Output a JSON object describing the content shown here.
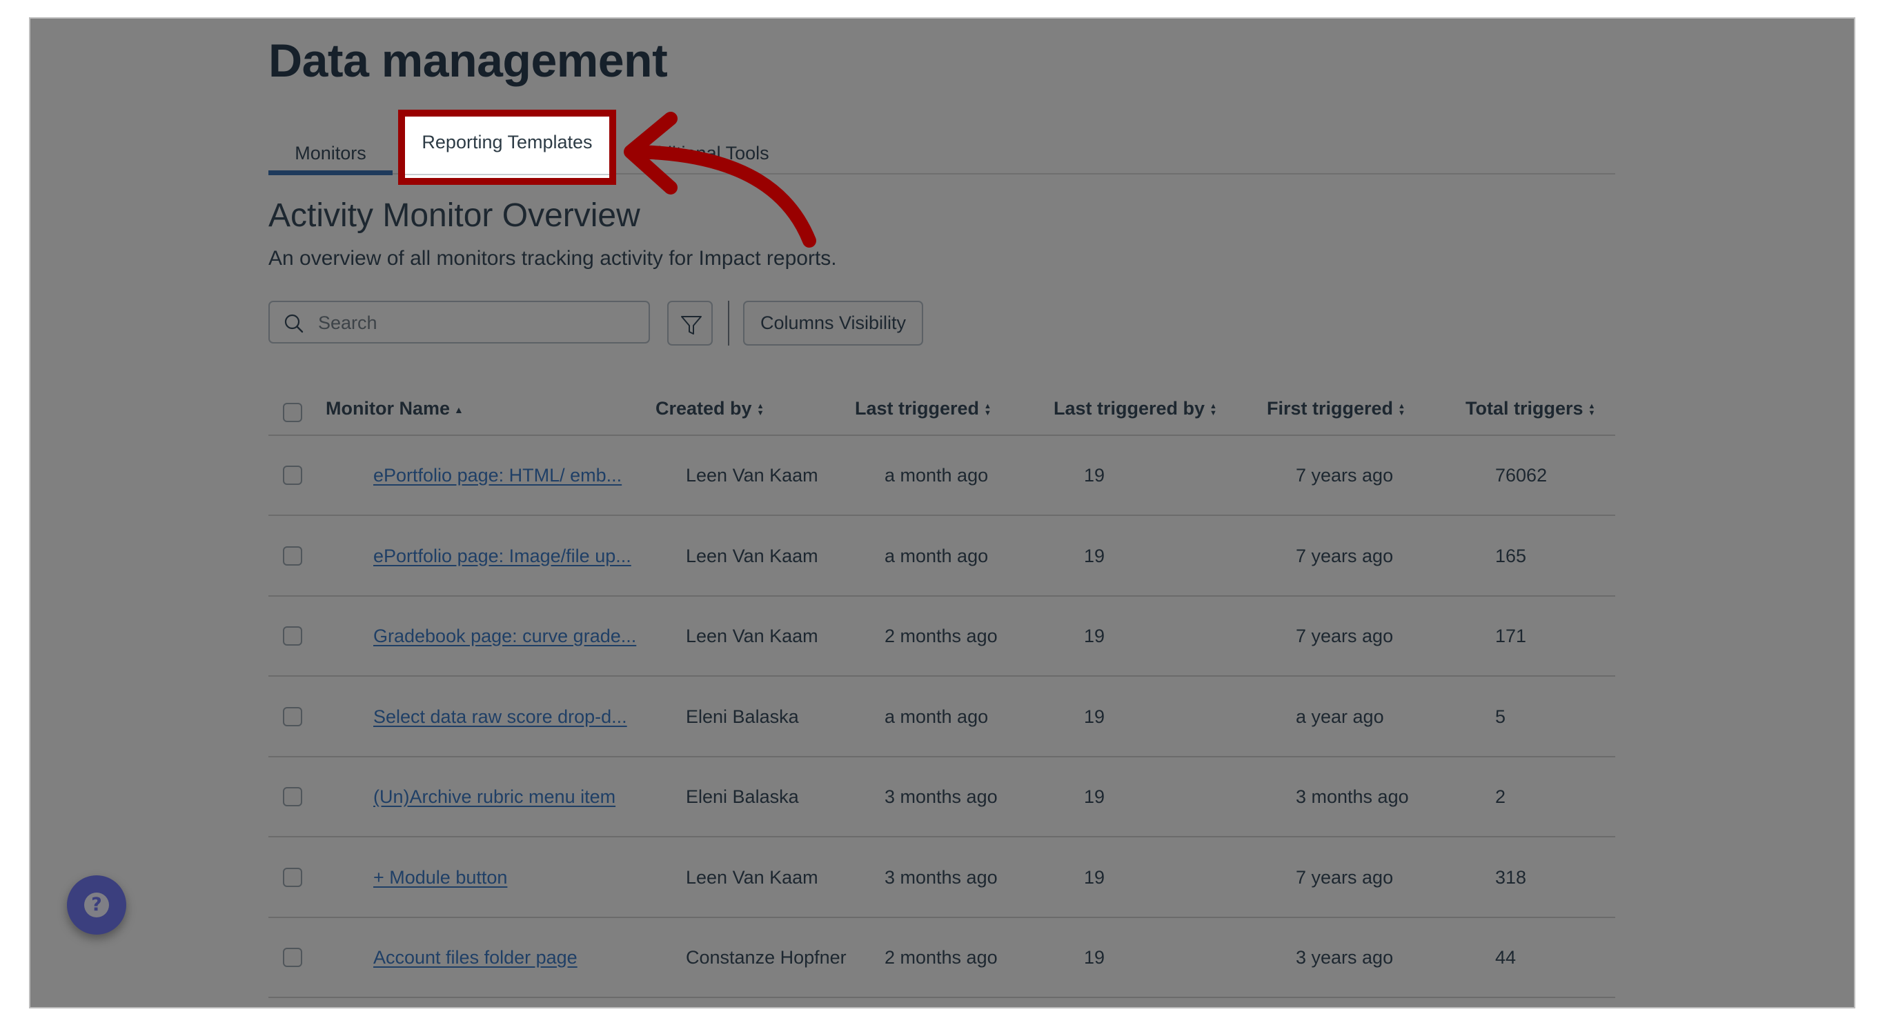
{
  "page": {
    "title": "Data management"
  },
  "tabs": [
    {
      "label": "Monitors",
      "selected": true
    },
    {
      "label": "Reporting Templates",
      "selected": false,
      "highlighted": true
    },
    {
      "label": "Additional Tools",
      "selected": false
    }
  ],
  "annotation": {
    "highlight_color": "#990000",
    "arrow_color": "#990000",
    "points_to": "Reporting Templates"
  },
  "section": {
    "title": "Activity Monitor Overview",
    "description": "An overview of all monitors tracking activity for Impact reports."
  },
  "toolbar": {
    "search_placeholder": "Search",
    "search_value": "",
    "filter_icon": "filter-icon",
    "columns_visibility_label": "Columns Visibility"
  },
  "table": {
    "columns": [
      {
        "label": "Monitor Name",
        "sort": "ascending"
      },
      {
        "label": "Created by",
        "sort": "none"
      },
      {
        "label": "Last triggered",
        "sort": "none"
      },
      {
        "label": "Last triggered by",
        "sort": "none"
      },
      {
        "label": "First triggered",
        "sort": "none"
      },
      {
        "label": "Total triggers",
        "sort": "none"
      }
    ],
    "rows": [
      {
        "name": "ePortfolio page: HTML/ emb...",
        "created_by": "Leen Van Kaam",
        "last_triggered": "a month ago",
        "last_triggered_by": "19",
        "first_triggered": "7 years ago",
        "total_triggers": "76062"
      },
      {
        "name": "ePortfolio page: Image/file up...",
        "created_by": "Leen Van Kaam",
        "last_triggered": "a month ago",
        "last_triggered_by": "19",
        "first_triggered": "7 years ago",
        "total_triggers": "165"
      },
      {
        "name": "Gradebook page: curve grade...",
        "created_by": "Leen Van Kaam",
        "last_triggered": "2 months ago",
        "last_triggered_by": "19",
        "first_triggered": "7 years ago",
        "total_triggers": "171"
      },
      {
        "name": "Select data raw score drop-d...",
        "created_by": "Eleni Balaska",
        "last_triggered": "a month ago",
        "last_triggered_by": "19",
        "first_triggered": "a year ago",
        "total_triggers": "5"
      },
      {
        "name": "(Un)Archive rubric menu item",
        "created_by": "Eleni Balaska",
        "last_triggered": "3 months ago",
        "last_triggered_by": "19",
        "first_triggered": "3 months ago",
        "total_triggers": "2"
      },
      {
        "name": "+ Module button",
        "created_by": "Leen Van Kaam",
        "last_triggered": "3 months ago",
        "last_triggered_by": "19",
        "first_triggered": "7 years ago",
        "total_triggers": "318"
      },
      {
        "name": "Account files folder page",
        "created_by": "Constanze Hopfner",
        "last_triggered": "2 months ago",
        "last_triggered_by": "19",
        "first_triggered": "3 years ago",
        "total_triggers": "44"
      }
    ]
  },
  "help": {
    "icon": "help-icon",
    "glyph": "?"
  },
  "colors": {
    "overlay": "#808080",
    "link": "#1f3f66",
    "tab_underline": "#1e3a5c",
    "help_button": "#3b3f7e"
  }
}
